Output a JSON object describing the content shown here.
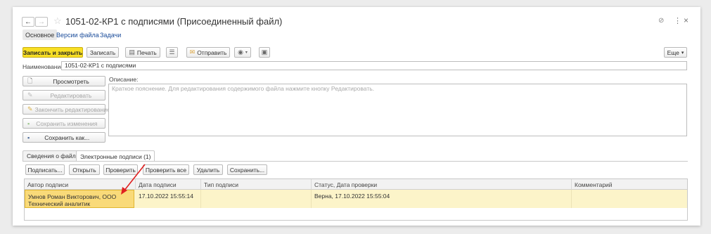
{
  "window": {
    "title": "1051-02-КР1 с подписями (Присоединенный файл)",
    "nav": {
      "back": "←",
      "forward": "→"
    },
    "star_icon": "star-icon",
    "controls": {
      "link": "🔗",
      "more": "⋮",
      "close": "×"
    }
  },
  "tabs": [
    {
      "label": "Основное",
      "active": true
    },
    {
      "label": "Версии файла",
      "active": false
    },
    {
      "label": "Задачи",
      "active": false
    }
  ],
  "toolbar": {
    "save_close": "Записать и закрыть",
    "save": "Записать",
    "print": "Печать",
    "send": "Отправить",
    "more": "Еще",
    "more_arrow": "▾"
  },
  "name_field": {
    "label": "Наименование:",
    "value": "1051-02-КР1 с подписями"
  },
  "side_buttons": [
    {
      "label": "Просмотреть",
      "icon": "document-icon",
      "disabled": false
    },
    {
      "label": "Редактировать",
      "icon": "edit-icon",
      "disabled": true
    },
    {
      "label": "Закончить редактирование",
      "icon": "finish-edit-icon",
      "disabled": true
    },
    {
      "label": "Сохранить изменения",
      "icon": "save-changes-icon",
      "disabled": true
    },
    {
      "label": "Сохранить как...",
      "icon": "floppy-icon",
      "disabled": false
    }
  ],
  "description": {
    "label": "Описание:",
    "placeholder": "Краткое пояснение. Для редактирования содержимого файла нажмите кнопку Редактировать."
  },
  "lower_tabs": [
    {
      "label": "Сведения о файле",
      "active": false
    },
    {
      "label": "Электронные подписи (1)",
      "active": true
    }
  ],
  "signature_buttons": {
    "sign": "Подписать...",
    "open": "Открыть",
    "verify": "Проверить",
    "verify_all": "Проверить все",
    "delete": "Удалить",
    "save": "Сохранить..."
  },
  "signatures_table": {
    "columns": [
      "Автор подписи",
      "Дата подписи",
      "Тип подписи",
      "Статус, Дата проверки",
      "Комментарий"
    ],
    "rows": [
      {
        "author_line1": "Умнов Роман Викторович, ООО",
        "author_line2": "Технический аналитик",
        "date": "17.10.2022 15:55:14",
        "type": "",
        "status": "Верна, 17.10.2022 15:55:04",
        "comment": ""
      }
    ]
  },
  "annotation": {
    "arrow_color": "#e02020"
  }
}
